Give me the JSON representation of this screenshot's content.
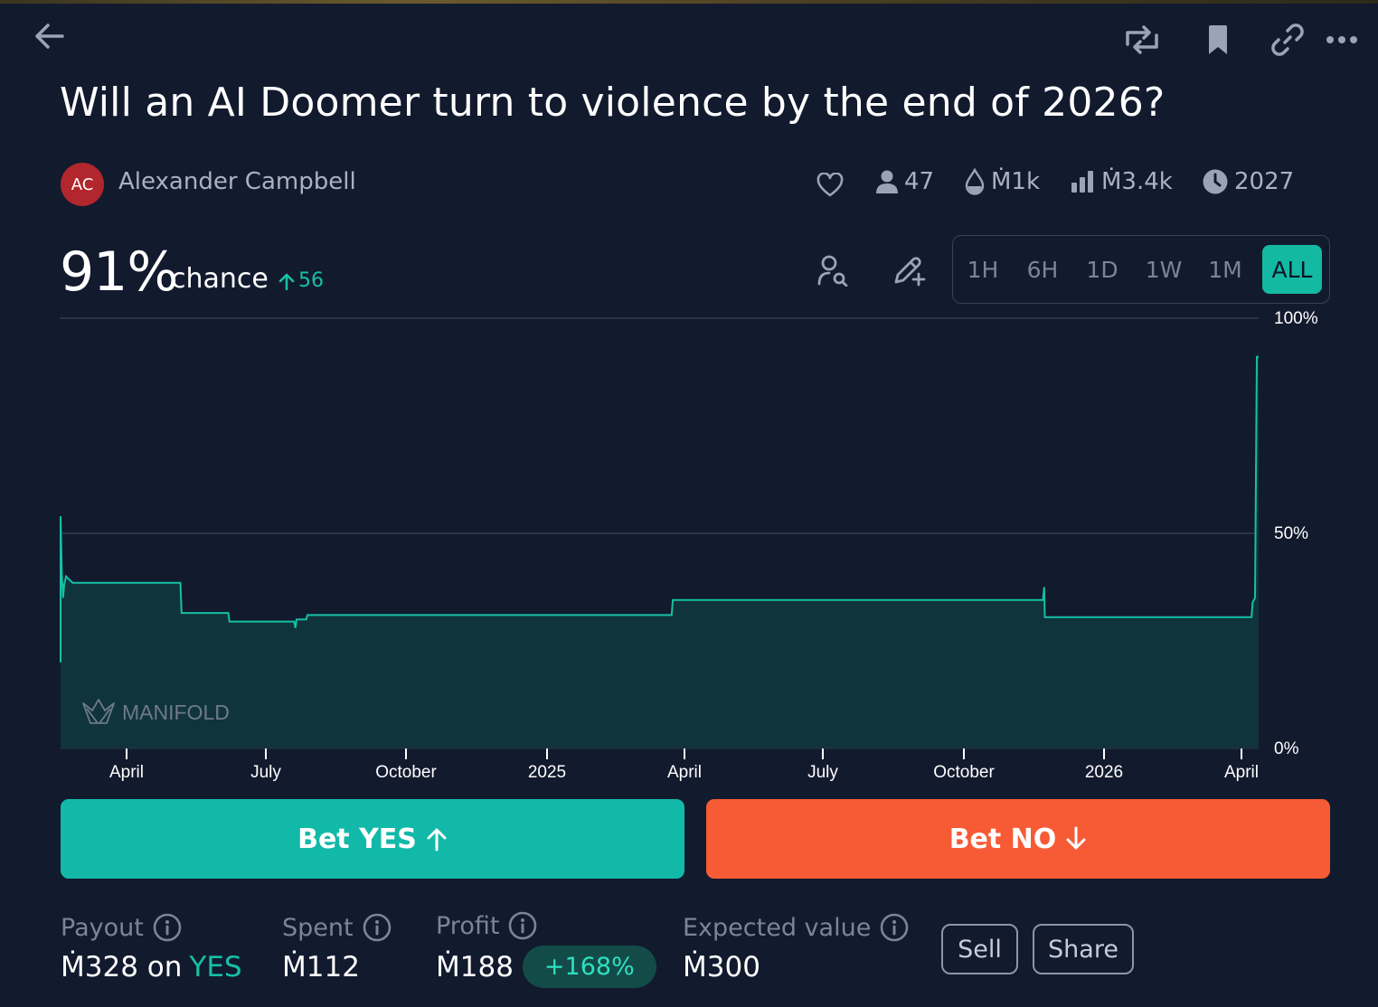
{
  "header": {
    "back_icon": "arrow-left-icon",
    "actions": [
      "repost-icon",
      "bookmark-icon",
      "link-icon",
      "more-icon"
    ]
  },
  "market": {
    "title": "Will an AI Doomer turn to violence by the end of 2026?",
    "author_initials": "AC",
    "author_name": "Alexander Campbell",
    "traders": "47",
    "liquidity": "Ṁ1k",
    "volume": "Ṁ3.4k",
    "close_year": "2027"
  },
  "probability": {
    "value": "91%",
    "label": "chance",
    "change": "56"
  },
  "time_ranges": [
    "1H",
    "6H",
    "1D",
    "1W",
    "1M",
    "ALL"
  ],
  "selected_range": "ALL",
  "chart_data": {
    "type": "area",
    "y_ticks": [
      "100%",
      "50%",
      "0%"
    ],
    "ylim": [
      0,
      100
    ],
    "x_ticks": [
      "April",
      "July",
      "October",
      "2025",
      "April",
      "July",
      "October",
      "2026",
      "April"
    ],
    "watermark": "MANIFOLD",
    "line_color": "#16c0a6",
    "fill_color": "#10343b",
    "points": [
      [
        0,
        20
      ],
      [
        0,
        54
      ],
      [
        0.1,
        41
      ],
      [
        0.2,
        35
      ],
      [
        0.3,
        38
      ],
      [
        0.45,
        40
      ],
      [
        1,
        38.5
      ],
      [
        10,
        38.5
      ],
      [
        10.1,
        31.5
      ],
      [
        14,
        31.5
      ],
      [
        14.1,
        29.5
      ],
      [
        19.5,
        29.5
      ],
      [
        19.6,
        28
      ],
      [
        19.7,
        30
      ],
      [
        20.5,
        30
      ],
      [
        20.6,
        31
      ],
      [
        32,
        31
      ],
      [
        51,
        31
      ],
      [
        51.1,
        34.5
      ],
      [
        82,
        34.5
      ],
      [
        82.1,
        37.5
      ],
      [
        82.15,
        30.5
      ],
      [
        99.4,
        30.5
      ],
      [
        99.5,
        34
      ],
      [
        99.7,
        35
      ],
      [
        99.85,
        91
      ],
      [
        100,
        91
      ]
    ]
  },
  "actions": {
    "bet_yes": "Bet YES",
    "bet_no": "Bet NO",
    "sell": "Sell",
    "share": "Share"
  },
  "position": {
    "payout_label": "Payout",
    "payout_value": "Ṁ328 on",
    "payout_outcome": "YES",
    "spent_label": "Spent",
    "spent_value": "Ṁ112",
    "profit_label": "Profit",
    "profit_value": "Ṁ188",
    "profit_pct": "+168%",
    "ev_label": "Expected value",
    "ev_value": "Ṁ300"
  },
  "colors": {
    "background": "#121a2e",
    "yes": "#13b9a8",
    "no": "#f75b36",
    "accent": "#16c0a6"
  }
}
